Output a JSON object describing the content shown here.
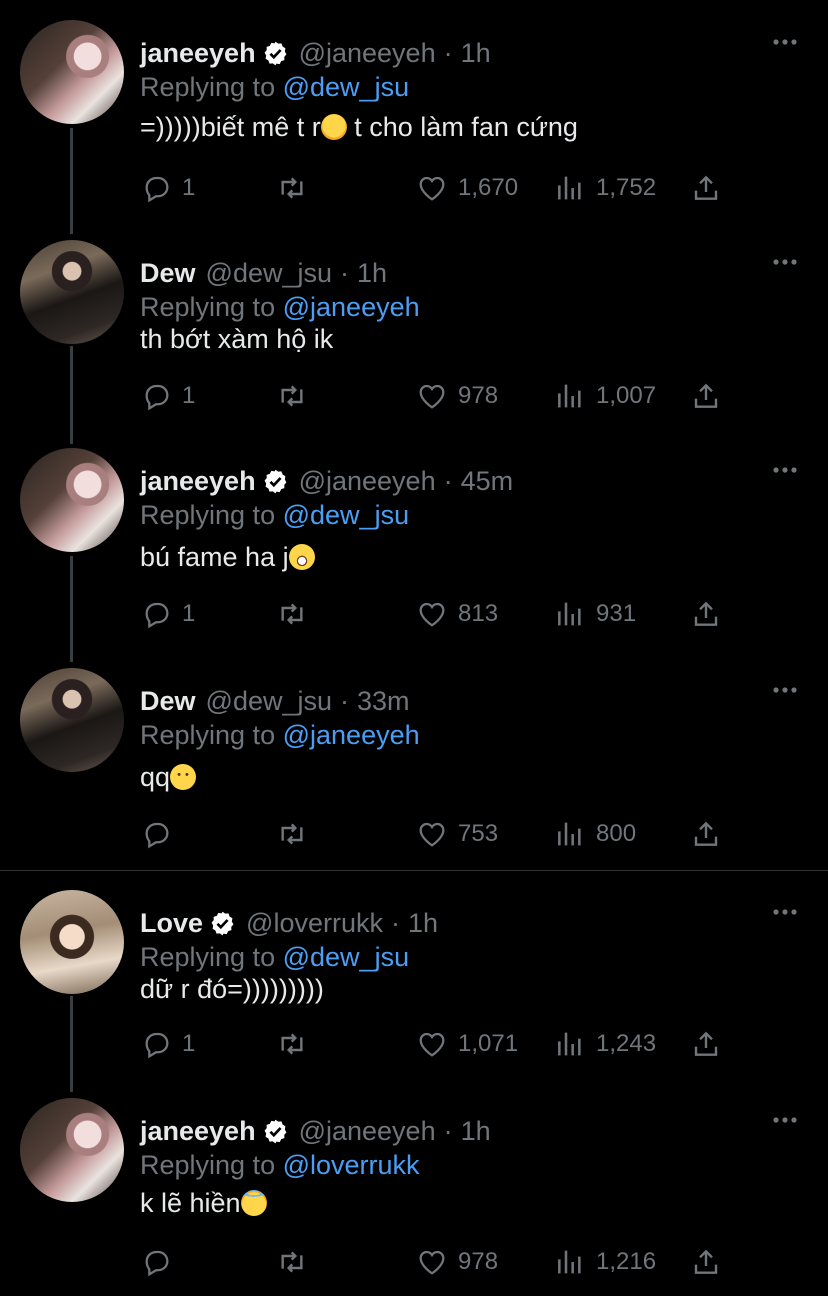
{
  "tweets": [
    {
      "name": "janeeyeh",
      "verified": true,
      "handle": "@janeeyeh",
      "time": "1h",
      "reply_prefix": "Replying to",
      "reply_to": "@dew_jsu",
      "text_before": "=)))))biết mê t r",
      "emoji": "hugging-face-emoji",
      "text_after": " t cho làm fan cứng",
      "replies": "1",
      "retweets": "",
      "likes": "1,670",
      "views": "1,752"
    },
    {
      "name": "Dew",
      "verified": false,
      "handle": "@dew_jsu",
      "time": "1h",
      "reply_prefix": "Replying to",
      "reply_to": "@janeeyeh",
      "text_before": "th bớt xàm hộ ik",
      "emoji": "",
      "text_after": "",
      "replies": "1",
      "retweets": "",
      "likes": "978",
      "views": "1,007"
    },
    {
      "name": "janeeyeh",
      "verified": true,
      "handle": "@janeeyeh",
      "time": "45m",
      "reply_prefix": "Replying to",
      "reply_to": "@dew_jsu",
      "text_before": "bú fame ha j",
      "emoji": "grinning-face-emoji",
      "text_after": "",
      "replies": "1",
      "retweets": "",
      "likes": "813",
      "views": "931"
    },
    {
      "name": "Dew",
      "verified": false,
      "handle": "@dew_jsu",
      "time": "33m",
      "reply_prefix": "Replying to",
      "reply_to": "@janeeyeh",
      "text_before": "qq",
      "emoji": "slightly-smiling-face-emoji",
      "text_after": "",
      "replies": "",
      "retweets": "",
      "likes": "753",
      "views": "800"
    },
    {
      "name": "Love",
      "verified": true,
      "handle": "@loverrukk",
      "time": "1h",
      "reply_prefix": "Replying to",
      "reply_to": "@dew_jsu",
      "text_before": "dữ r đó=)))))))))",
      "emoji": "",
      "text_after": "",
      "replies": "1",
      "retweets": "",
      "likes": "1,071",
      "views": "1,243"
    },
    {
      "name": "janeeyeh",
      "verified": true,
      "handle": "@janeeyeh",
      "time": "1h",
      "reply_prefix": "Replying to",
      "reply_to": "@loverrukk",
      "text_before": "k lẽ hiền",
      "emoji": "smiling-face-with-halo-emoji",
      "text_after": "",
      "replies": "",
      "retweets": "",
      "likes": "978",
      "views": "1,216"
    }
  ],
  "colors": {
    "background": "#000000",
    "text": "#e7e9ea",
    "muted": "#71767b",
    "link": "#4c9ef5",
    "verified": "#ffffff"
  }
}
